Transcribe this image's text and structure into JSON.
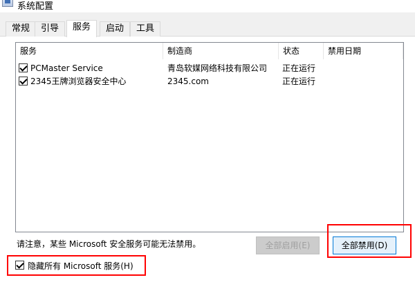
{
  "window": {
    "title": "系统配置"
  },
  "tabs": [
    {
      "label": "常规"
    },
    {
      "label": "引导"
    },
    {
      "label": "服务",
      "active": true
    },
    {
      "label": "启动"
    },
    {
      "label": "工具"
    }
  ],
  "services_table": {
    "columns": [
      "服务",
      "制造商",
      "状态",
      "禁用日期"
    ],
    "rows": [
      {
        "checked": true,
        "name": "PCMaster Service",
        "manufacturer": "青岛软媒网络科技有限公司",
        "status": "正在运行",
        "disabled_date": ""
      },
      {
        "checked": true,
        "name": "2345王牌浏览器安全中心",
        "manufacturer": "2345.com",
        "status": "正在运行",
        "disabled_date": ""
      }
    ]
  },
  "note": "请注意，某些 Microsoft 安全服务可能无法禁用。",
  "buttons": {
    "enable_all": "全部启用(E)",
    "disable_all": "全部禁用(D)"
  },
  "hide_microsoft": {
    "checked": true,
    "label": "隐藏所有 Microsoft 服务(H)"
  },
  "colors": {
    "highlight": "#ff0000",
    "window_bg": "#f0f0f0",
    "panel_bg": "#ffffff"
  }
}
